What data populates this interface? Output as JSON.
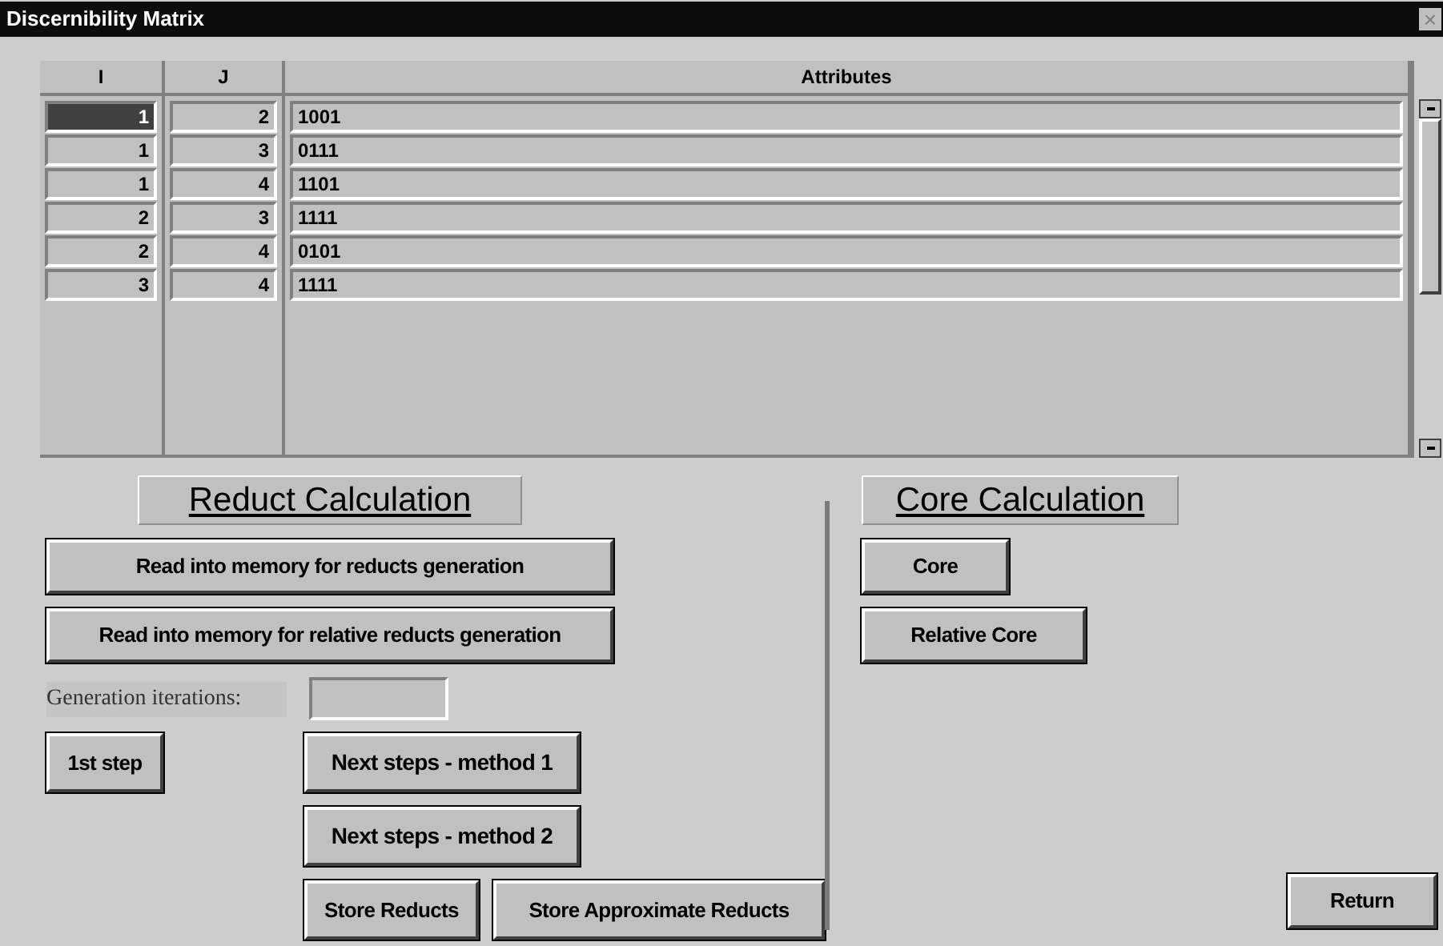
{
  "window": {
    "title": "Discernibility Matrix",
    "close": "×"
  },
  "table": {
    "columns": [
      "I",
      "J",
      "Attributes"
    ],
    "rows": [
      {
        "i": "1",
        "j": "2",
        "attributes": "1001",
        "selected": true
      },
      {
        "i": "1",
        "j": "3",
        "attributes": "0111",
        "selected": false
      },
      {
        "i": "1",
        "j": "4",
        "attributes": "1101",
        "selected": false
      },
      {
        "i": "2",
        "j": "3",
        "attributes": "1111",
        "selected": false
      },
      {
        "i": "2",
        "j": "4",
        "attributes": "0101",
        "selected": false
      },
      {
        "i": "3",
        "j": "4",
        "attributes": "1111",
        "selected": false
      }
    ]
  },
  "reduct": {
    "heading": "Reduct Calculation",
    "read_button": "Read into memory for reducts generation",
    "read_relative_button": "Read into memory for relative reducts generation",
    "iterations_label": "Generation iterations:",
    "first_step_button": "1st step",
    "method1_button": "Next steps - method 1",
    "method2_button": "Next steps - method 2",
    "store_button": "Store Reducts",
    "store_approx_button": "Store Approximate Reducts"
  },
  "core": {
    "heading": "Core Calculation",
    "core_button": "Core",
    "relative_core_button": "Relative Core"
  },
  "return_button": "Return"
}
